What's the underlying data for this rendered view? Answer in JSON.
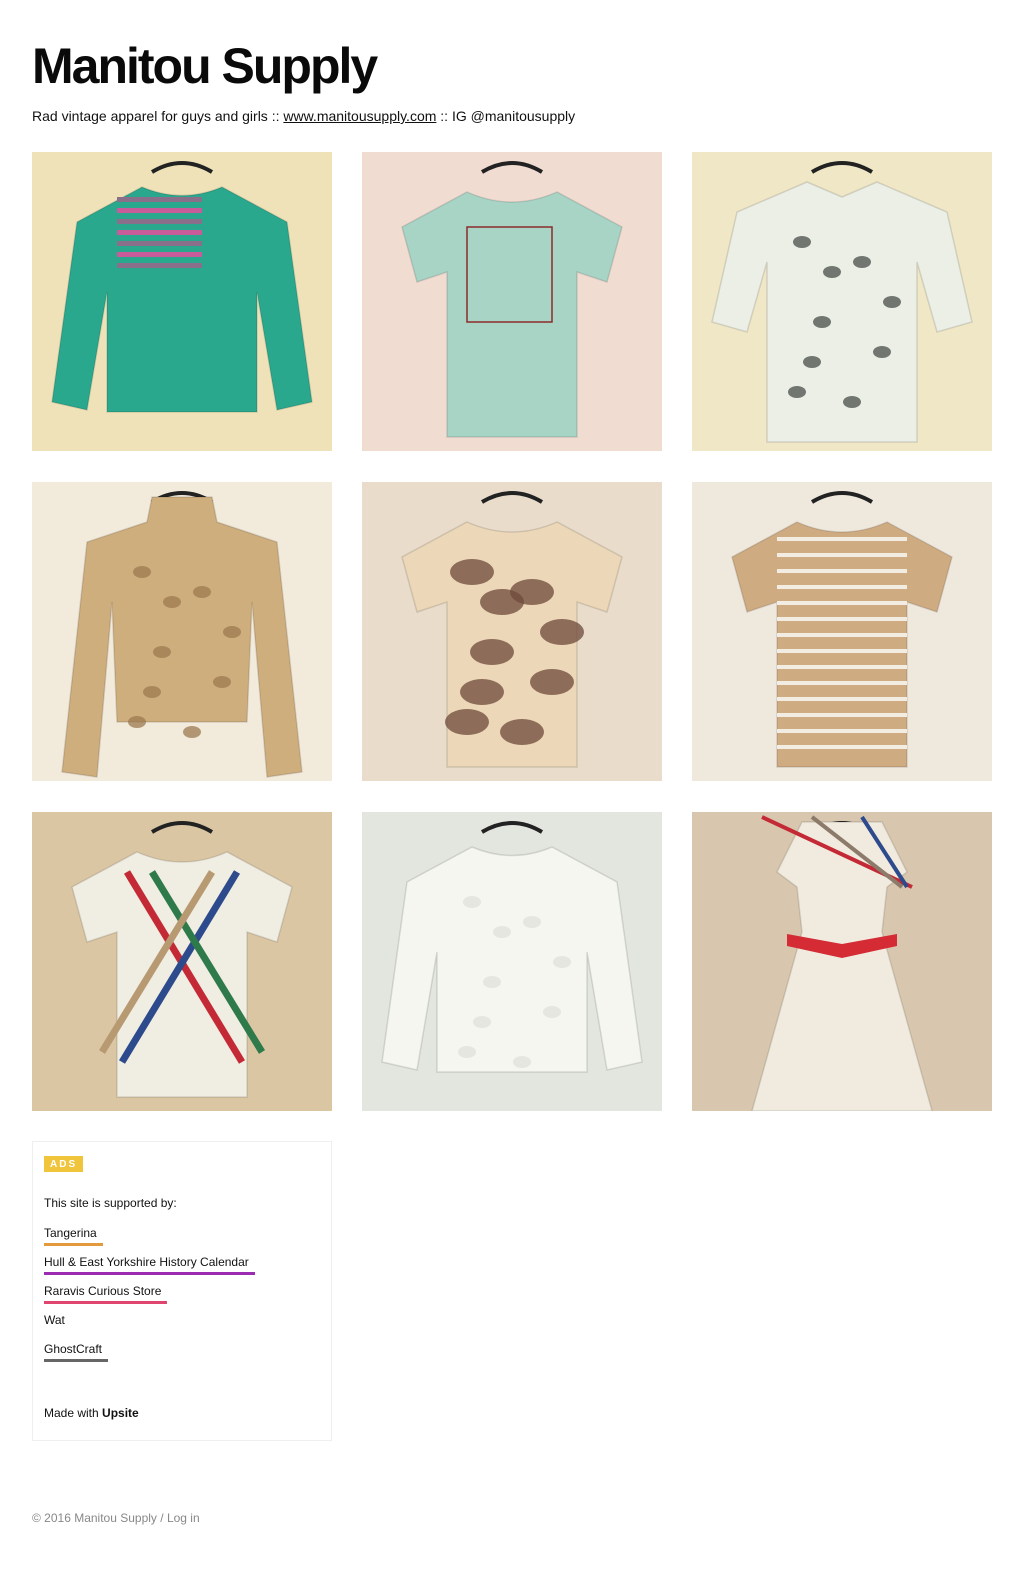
{
  "site": {
    "title": "Manitou Supply",
    "tagline_prefix": "Rad vintage apparel for guys and girls :: ",
    "tagline_link": "www.manitousupply.com",
    "tagline_suffix": " :: IG @manitousupply"
  },
  "products": [
    {
      "name": "teal-striped-sweatshirt",
      "bg": "#efe2b8",
      "garment": "#2aa88e",
      "accent": "#8a6f8a",
      "icon": "sweatshirt"
    },
    {
      "name": "mint-going-up-tee",
      "bg": "#f1dcd2",
      "garment": "#a8d4c6",
      "accent": "#8c2b2b",
      "icon": "tshirt"
    },
    {
      "name": "paisley-button-shirt",
      "bg": "#f0e7c6",
      "garment": "#ecefe6",
      "accent": "#4a4d4a",
      "icon": "shirt"
    },
    {
      "name": "lace-turtleneck-top",
      "bg": "#f2eadb",
      "garment": "#cfae7e",
      "accent": "#9c7a50",
      "icon": "longsleeve"
    },
    {
      "name": "desert-camo-tee",
      "bg": "#e9dccb",
      "garment": "#ecd8b8",
      "accent": "#6e4a3a",
      "icon": "tshirt"
    },
    {
      "name": "tan-striped-pocket-tee",
      "bg": "#efe8dd",
      "garment": "#cfab82",
      "accent": "#f2ece2",
      "icon": "tshirt"
    },
    {
      "name": "argyle-ribbon-sweater",
      "bg": "#dbc6a3",
      "garment": "#f0ede2",
      "accent": "#2d4a8c",
      "icon": "tshirt"
    },
    {
      "name": "white-knit-sweater",
      "bg": "#e3e6df",
      "garment": "#f6f6f1",
      "accent": "#c8c8bf",
      "icon": "sweatshirt"
    },
    {
      "name": "cream-belted-dress",
      "bg": "#d8c7ae",
      "garment": "#f1ebdf",
      "accent": "#d42b35",
      "icon": "dress"
    }
  ],
  "ads": {
    "badge": "ADS",
    "intro": "This site is supported by:",
    "sponsors": [
      {
        "label": "Tangerina",
        "color": "#e39a3c"
      },
      {
        "label": "Hull & East Yorkshire History Calendar",
        "color": "#9b2bb0"
      },
      {
        "label": "Raravis Curious Store",
        "color": "#e0456f"
      },
      {
        "label": "Wat",
        "color": "#ffffff"
      },
      {
        "label": "GhostCraft",
        "color": "#666666"
      }
    ],
    "made_with_prefix": "Made with ",
    "made_with_brand": "Upsite"
  },
  "footer": {
    "copyright": "© 2016 Manitou Supply",
    "separator": " / ",
    "login": "Log in"
  }
}
